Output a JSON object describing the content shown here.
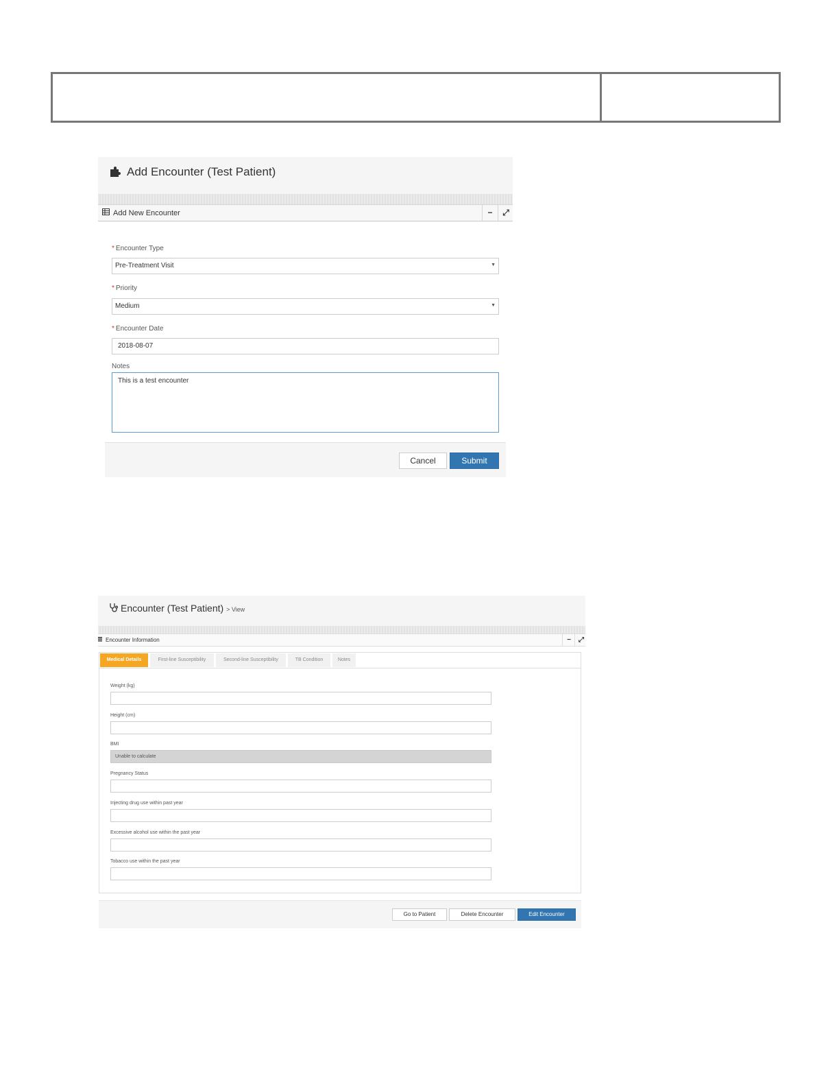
{
  "add_encounter": {
    "title_icon": "puzzle-piece-icon",
    "title": "Add Encounter (Test Patient)",
    "widget": {
      "icon": "table-icon",
      "title": "Add New Encounter",
      "collapse_symbol": "−",
      "fullscreen_symbol": "⤢"
    },
    "fields": {
      "encounter_type": {
        "required_mark": "*",
        "label": "Encounter Type",
        "value": "Pre-Treatment Visit"
      },
      "priority": {
        "required_mark": "*",
        "label": "Priority",
        "value": "Medium"
      },
      "encounter_date": {
        "required_mark": "*",
        "label": "Encounter Date",
        "value": "2018-08-07"
      },
      "notes": {
        "label": "Notes",
        "value": "This is a test encounter"
      }
    },
    "buttons": {
      "cancel": "Cancel",
      "submit": "Submit"
    }
  },
  "view_encounter": {
    "title_icon": "stethoscope-icon",
    "title": "Encounter (Test Patient)",
    "title_suffix": "> View",
    "widget": {
      "icon": "list-icon",
      "title": "Encounter Information",
      "collapse_symbol": "−",
      "fullscreen_symbol": "⤢"
    },
    "tabs": [
      {
        "label": "Medical Details",
        "active": true
      },
      {
        "label": "First-line Susceptibility",
        "active": false
      },
      {
        "label": "Second-line Susceptibility",
        "active": false
      },
      {
        "label": "TB Condition",
        "active": false
      },
      {
        "label": "Notes",
        "active": false
      }
    ],
    "fields": [
      {
        "label": "Weight (kg)",
        "value": ""
      },
      {
        "label": "Height (cm)",
        "value": ""
      },
      {
        "label": "BMI",
        "value": "Unable to calculate"
      },
      {
        "label": "Pregnancy Status",
        "value": ""
      },
      {
        "label": "Injecting drug use within past year",
        "value": ""
      },
      {
        "label": "Excessive alcohol use within the past year",
        "value": ""
      },
      {
        "label": "Tobacco use within the past year",
        "value": ""
      }
    ],
    "buttons": {
      "go_to_patient": "Go to Patient",
      "delete": "Delete Encounter",
      "edit": "Edit Encounter"
    }
  },
  "colors": {
    "primary": "#3276b1",
    "active_tab": "#f5a623",
    "required": "#c0392b"
  }
}
